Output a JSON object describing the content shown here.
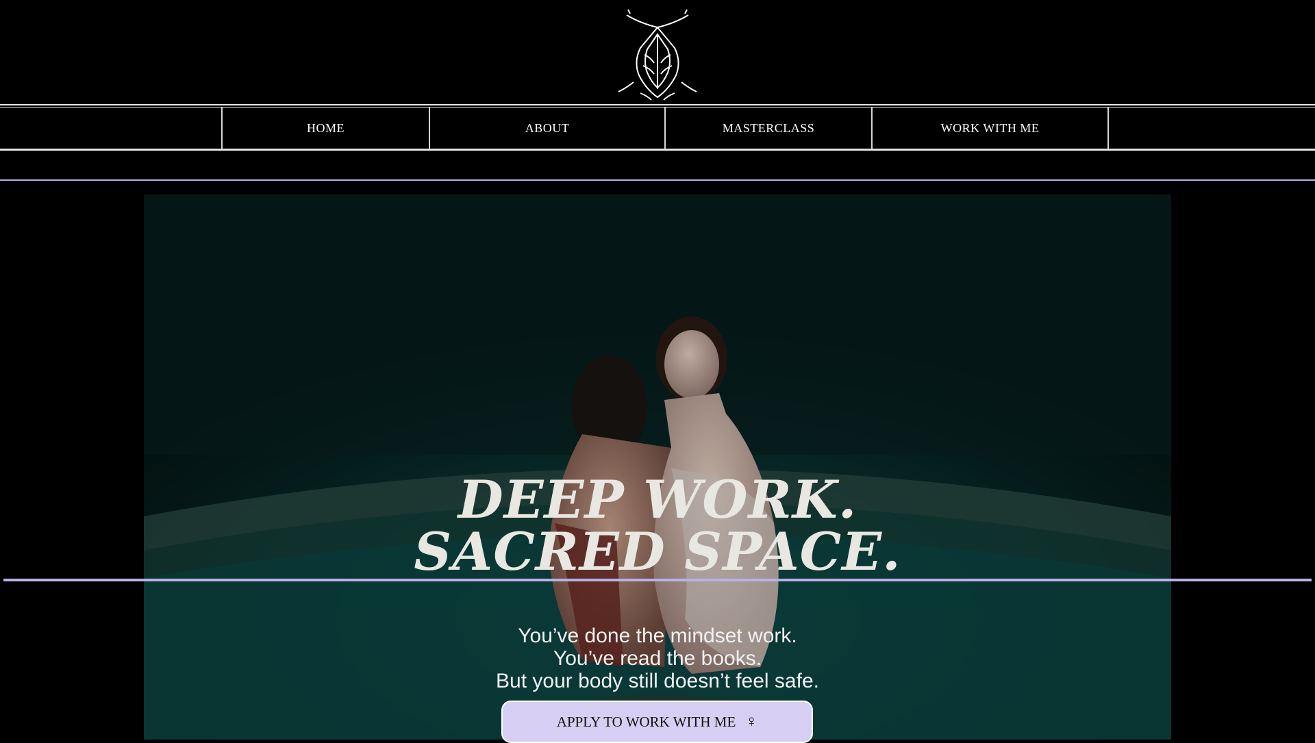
{
  "header": {
    "logo_icon": "twin-tigers-crest-icon"
  },
  "nav": {
    "items": [
      {
        "label": ""
      },
      {
        "label": "HOME"
      },
      {
        "label": "ABOUT"
      },
      {
        "label": "MASTERCLASS"
      },
      {
        "label": "WORK WITH ME"
      },
      {
        "label": ""
      }
    ]
  },
  "hero": {
    "title_line1": "DEEP WORK.",
    "title_line2": "SACRED SPACE.",
    "body_line1": "You’ve done the mindset work.",
    "body_line2": "You’ve read the books.",
    "body_line3": "But your body still doesn’t feel safe.",
    "cta_label": "APPLY TO WORK WITH ME",
    "cta_icon": "female-symbol-icon",
    "cta_icon_glyph": "♀"
  },
  "colors": {
    "background": "#000000",
    "accent_lavender": "#b9b1e6",
    "button_bg": "#d6cff3",
    "title_text": "#e9e7e2"
  }
}
